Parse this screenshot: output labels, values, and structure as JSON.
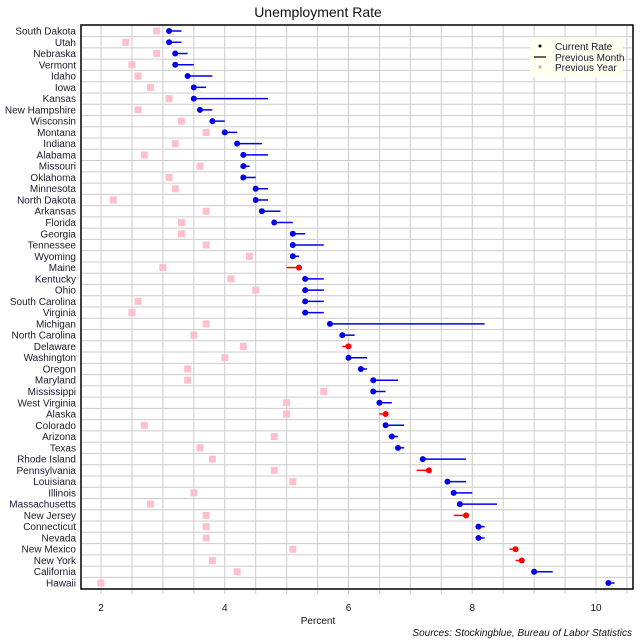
{
  "chart_data": {
    "type": "scatter",
    "title": "Unemployment Rate",
    "xlabel": "Percent",
    "ylabel": "",
    "xlim": [
      1.68,
      10.6
    ],
    "xticks": [
      2,
      4,
      6,
      8,
      10
    ],
    "grid": true,
    "legend_position": "top-right",
    "legend": [
      {
        "label": "Current Rate",
        "marker": "dot"
      },
      {
        "label": "Previous Month",
        "marker": "line"
      },
      {
        "label": "Previous Year",
        "marker": "square"
      }
    ],
    "source": "Sources: Stockingblue, Bureau of Labor Statistics",
    "colors": {
      "improved": "#0000ee",
      "worsened": "#ff0000",
      "previous_year": "#ffc0cb",
      "legend_bg": "#fffff0",
      "grid": "#cccccc"
    },
    "series_names": [
      "Current Rate",
      "Previous Month",
      "Previous Year"
    ],
    "categories": [
      "South Dakota",
      "Utah",
      "Nebraska",
      "Vermont",
      "Idaho",
      "Iowa",
      "Kansas",
      "New Hampshire",
      "Wisconsin",
      "Montana",
      "Indiana",
      "Alabama",
      "Missouri",
      "Oklahoma",
      "Minnesota",
      "North Dakota",
      "Arkansas",
      "Florida",
      "Georgia",
      "Tennessee",
      "Wyoming",
      "Maine",
      "Kentucky",
      "Ohio",
      "South Carolina",
      "Virginia",
      "Michigan",
      "North Carolina",
      "Delaware",
      "Washington",
      "Oregon",
      "Maryland",
      "Mississippi",
      "West Virginia",
      "Alaska",
      "Colorado",
      "Arizona",
      "Texas",
      "Rhode Island",
      "Pennsylvania",
      "Louisiana",
      "Illinois",
      "Massachusetts",
      "New Jersey",
      "Connecticut",
      "Nevada",
      "New Mexico",
      "New York",
      "California",
      "Hawaii"
    ],
    "current": [
      3.1,
      3.1,
      3.2,
      3.2,
      3.4,
      3.5,
      3.5,
      3.6,
      3.8,
      4.0,
      4.2,
      4.3,
      4.3,
      4.3,
      4.5,
      4.5,
      4.6,
      4.8,
      5.1,
      5.1,
      5.1,
      5.2,
      5.3,
      5.3,
      5.3,
      5.3,
      5.7,
      5.9,
      6.0,
      6.0,
      6.2,
      6.4,
      6.4,
      6.5,
      6.6,
      6.6,
      6.7,
      6.8,
      7.2,
      7.3,
      7.6,
      7.7,
      7.8,
      7.9,
      8.1,
      8.1,
      8.7,
      8.8,
      9.0,
      10.2
    ],
    "previous_month": [
      3.3,
      3.3,
      3.4,
      3.5,
      3.8,
      3.7,
      4.7,
      3.8,
      4.0,
      4.2,
      4.6,
      4.7,
      4.4,
      4.5,
      4.7,
      4.7,
      4.9,
      5.1,
      5.3,
      5.6,
      5.2,
      5.0,
      5.6,
      5.6,
      5.6,
      5.6,
      8.2,
      6.1,
      5.9,
      6.3,
      6.3,
      6.8,
      6.6,
      6.7,
      6.5,
      6.9,
      6.8,
      6.9,
      7.9,
      7.1,
      7.9,
      8.0,
      8.4,
      7.7,
      8.2,
      8.2,
      8.6,
      8.7,
      9.3,
      10.3
    ],
    "previous_year": [
      2.9,
      2.4,
      2.9,
      2.5,
      2.6,
      2.8,
      3.1,
      2.6,
      3.3,
      3.7,
      3.2,
      2.7,
      3.6,
      3.1,
      3.2,
      2.2,
      3.7,
      3.3,
      3.3,
      3.7,
      4.4,
      3.0,
      4.1,
      4.5,
      2.6,
      2.5,
      3.7,
      3.5,
      4.3,
      4.0,
      3.4,
      3.4,
      5.6,
      5.0,
      5.0,
      2.7,
      4.8,
      3.6,
      3.8,
      4.8,
      5.1,
      3.5,
      2.8,
      3.7,
      3.7,
      3.7,
      5.1,
      3.8,
      4.2,
      2.0
    ]
  }
}
